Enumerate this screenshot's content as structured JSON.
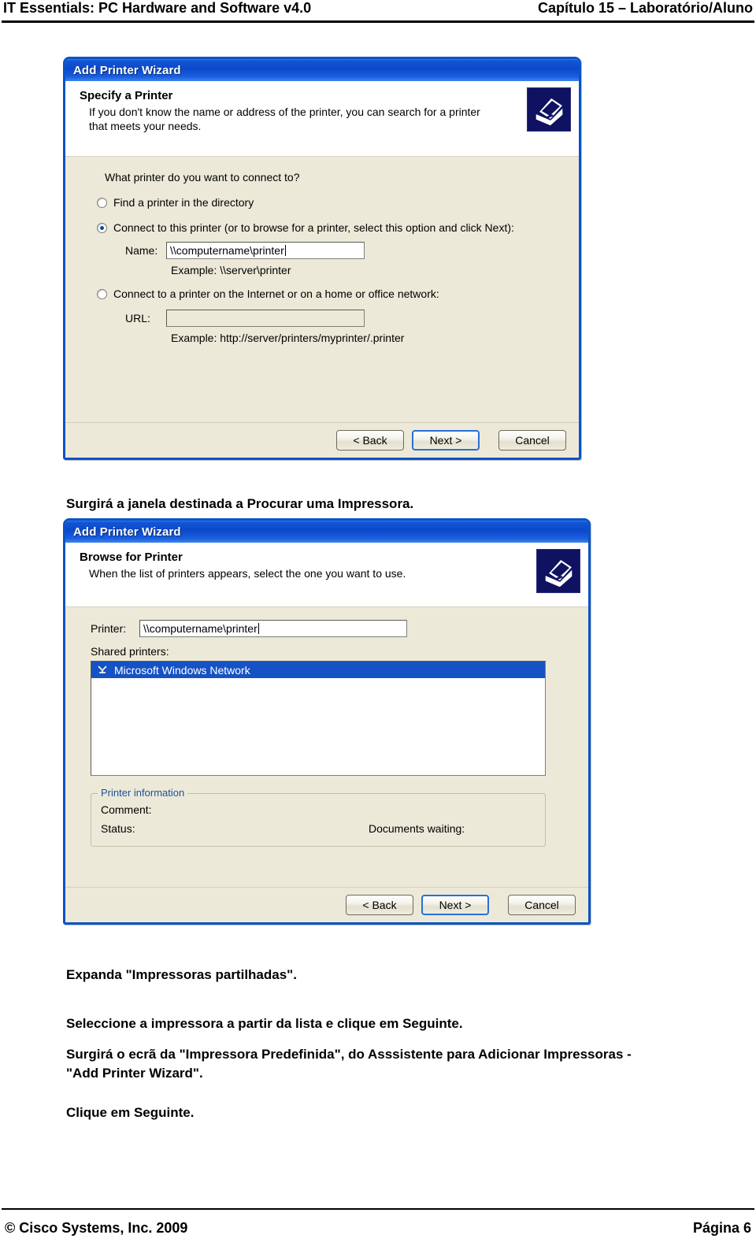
{
  "header": {
    "left": "IT Essentials: PC Hardware and Software v4.0",
    "right": "Capítulo 15 – Laboratório/Aluno"
  },
  "footer": {
    "copyright": "© Cisco Systems, Inc. 2009",
    "page": "Página 6"
  },
  "dialog1": {
    "title": "Add Printer Wizard",
    "banner_heading": "Specify a Printer",
    "banner_text": "If you don't know the name or address of the printer, you can search for a printer that meets your needs.",
    "icon": "printer-icon",
    "question": "What printer do you want to connect to?",
    "option_directory": "Find a printer in the directory",
    "option_this_printer": "Connect to this printer (or to browse for a printer, select this option and click Next):",
    "name_label": "Name:",
    "name_value": "\\\\computername\\printer",
    "name_example": "Example: \\\\server\\printer",
    "option_internet": "Connect to a printer on the Internet or on a home or office network:",
    "url_label": "URL:",
    "url_value": "",
    "url_example": "Example: http://server/printers/myprinter/.printer",
    "buttons": {
      "back": "< Back",
      "next": "Next >",
      "cancel": "Cancel"
    }
  },
  "caption1": "Surgirá a janela destinada a Procurar uma Impressora.",
  "dialog2": {
    "title": "Add Printer Wizard",
    "banner_heading": "Browse for Printer",
    "banner_text": "When the list of printers appears, select the one you want to use.",
    "icon": "printer-icon",
    "printer_label": "Printer:",
    "printer_value": "\\\\computername\\printer",
    "shared_label": "Shared printers:",
    "list_items": [
      {
        "label": "Microsoft Windows Network",
        "icon": "network-icon",
        "selected": true
      }
    ],
    "info_group_title": "Printer information",
    "comment_label": "Comment:",
    "comment_value": "",
    "status_label": "Status:",
    "status_value": "",
    "documents_waiting_label": "Documents waiting:",
    "documents_waiting_value": "",
    "buttons": {
      "back": "< Back",
      "next": "Next >",
      "cancel": "Cancel"
    }
  },
  "paragraphs": {
    "p1": "Expanda \"Impressoras partilhadas\".",
    "p2_pre": "Seleccione a impressora a partir da lista e clique em ",
    "p2_bold": "Seguinte",
    "p2_post": ".",
    "p3_line1": "Surgirá o ecrã da \"Impressora Predefinida\", do Asssistente para Adicionar Impressoras -",
    "p3_line2": "\"Add Printer Wizard\".",
    "p4_pre": "Clique em ",
    "p4_bold": "Seguinte",
    "p4_post": "."
  }
}
